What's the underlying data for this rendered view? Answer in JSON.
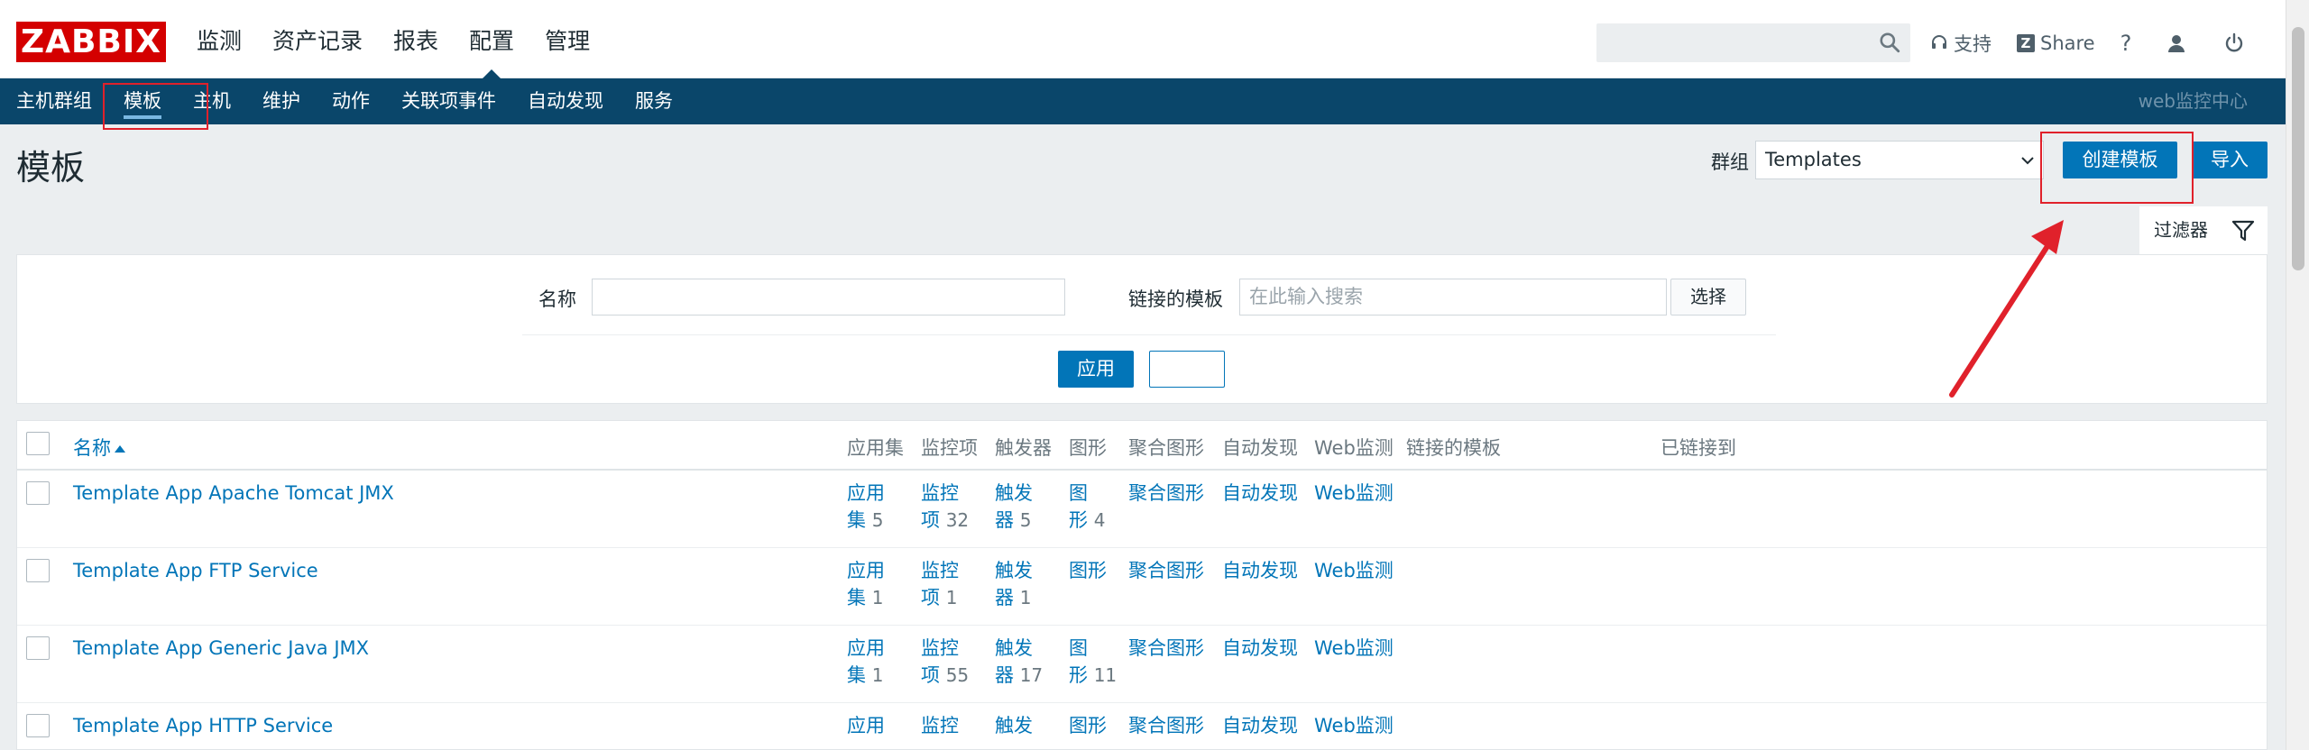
{
  "header": {
    "logo": "ZABBIX",
    "nav": [
      "监测",
      "资产记录",
      "报表",
      "配置",
      "管理"
    ],
    "active_nav": "配置",
    "support_label": "支持",
    "share_label": "Share",
    "help_label": "?",
    "share_badge": "Z"
  },
  "subnav": {
    "items": [
      "主机群组",
      "模板",
      "主机",
      "维护",
      "动作",
      "关联项事件",
      "自动发现",
      "服务"
    ],
    "active": "模板",
    "right_label": "web监控中心"
  },
  "page": {
    "title": "模板",
    "group_label": "群组",
    "group_value": "Templates",
    "create_button": "创建模板",
    "import_button": "导入",
    "filter_tab": "过滤器"
  },
  "filter": {
    "name_label": "名称",
    "name_value": "",
    "linked_label": "链接的模板",
    "linked_placeholder": "在此输入搜索",
    "select_button": "选择",
    "apply_button": "应用",
    "reset_button": ""
  },
  "table": {
    "headers": {
      "name": "名称",
      "apps": "应用集",
      "items": "监控项",
      "triggers": "触发器",
      "graphs": "图形",
      "screens": "聚合图形",
      "discovery": "自动发现",
      "web": "Web监测",
      "linked": "链接的模板",
      "linked_to": "已链接到"
    },
    "rows": [
      {
        "name": "Template App Apache Tomcat JMX",
        "apps_1": "应用",
        "apps_2": "集",
        "apps_count": "5",
        "items_1": "监控",
        "items_2": "项",
        "items_count": "32",
        "triggers_1": "触发",
        "triggers_2": "器",
        "triggers_count": "5",
        "graphs_1": "图",
        "graphs_2": "形",
        "graphs_count": "4",
        "screens": "聚合图形",
        "discovery": "自动发现",
        "web": "Web监测"
      },
      {
        "name": "Template App FTP Service",
        "apps_1": "应用",
        "apps_2": "集",
        "apps_count": "1",
        "items_1": "监控",
        "items_2": "项",
        "items_count": "1",
        "triggers_1": "触发",
        "triggers_2": "器",
        "triggers_count": "1",
        "graphs_1": "图形",
        "graphs_2": "",
        "graphs_count": "",
        "screens": "聚合图形",
        "discovery": "自动发现",
        "web": "Web监测"
      },
      {
        "name": "Template App Generic Java JMX",
        "apps_1": "应用",
        "apps_2": "集",
        "apps_count": "1",
        "items_1": "监控",
        "items_2": "项",
        "items_count": "55",
        "triggers_1": "触发",
        "triggers_2": "器",
        "triggers_count": "17",
        "graphs_1": "图",
        "graphs_2": "形",
        "graphs_count": "11",
        "screens": "聚合图形",
        "discovery": "自动发现",
        "web": "Web监测"
      },
      {
        "name": "Template App HTTP Service",
        "apps_1": "应用",
        "apps_2": "",
        "apps_count": "",
        "items_1": "监控",
        "items_2": "",
        "items_count": "",
        "triggers_1": "触发",
        "triggers_2": "",
        "triggers_count": "",
        "graphs_1": "图形",
        "graphs_2": "",
        "graphs_count": "",
        "screens": "聚合图形",
        "discovery": "自动发现",
        "web": "Web监测"
      }
    ]
  },
  "colors": {
    "brand_red": "#d40000",
    "subnav_bg": "#0a466a",
    "primary": "#0275b8",
    "annotation": "#e0212b"
  }
}
